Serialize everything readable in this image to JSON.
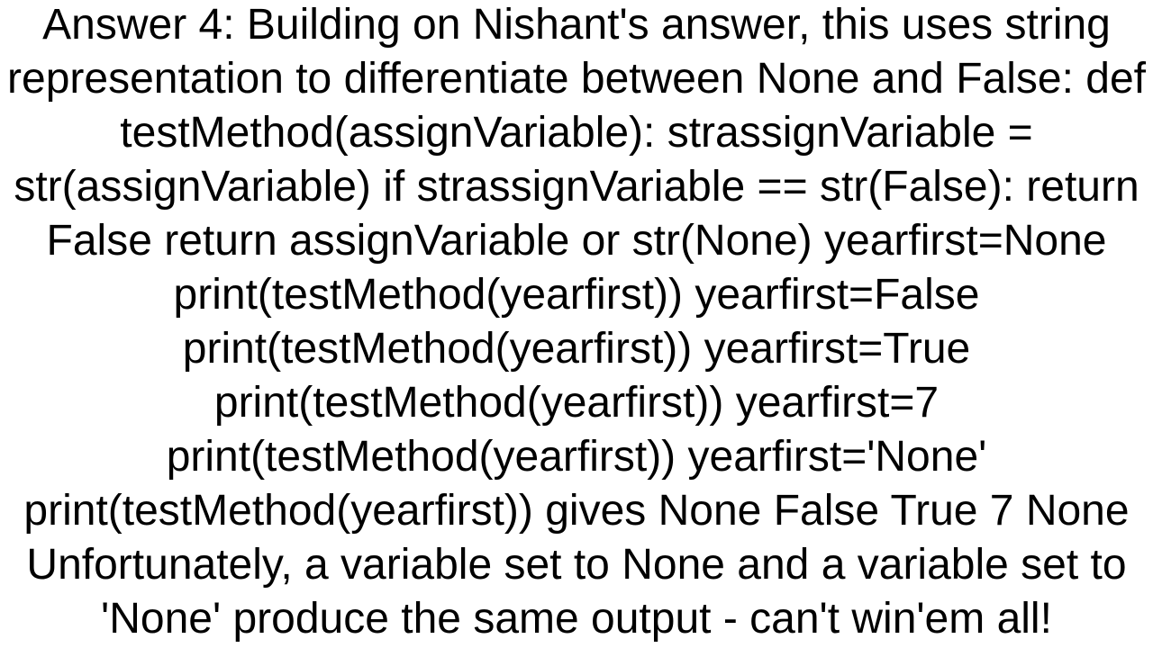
{
  "text": "Answer 4: Building on Nishant's answer, this uses string representation to differentiate between None and False: def testMethod(assignVariable):   strassignVariable = str(assignVariable)   if strassignVariable == str(False):     return False   return assignVariable or str(None)  yearfirst=None print(testMethod(yearfirst)) yearfirst=False print(testMethod(yearfirst)) yearfirst=True print(testMethod(yearfirst)) yearfirst=7 print(testMethod(yearfirst)) yearfirst='None' print(testMethod(yearfirst))  gives  None False True 7 None Unfortunately, a variable set to None and a variable set to 'None' produce the same output - can't win'em all!"
}
